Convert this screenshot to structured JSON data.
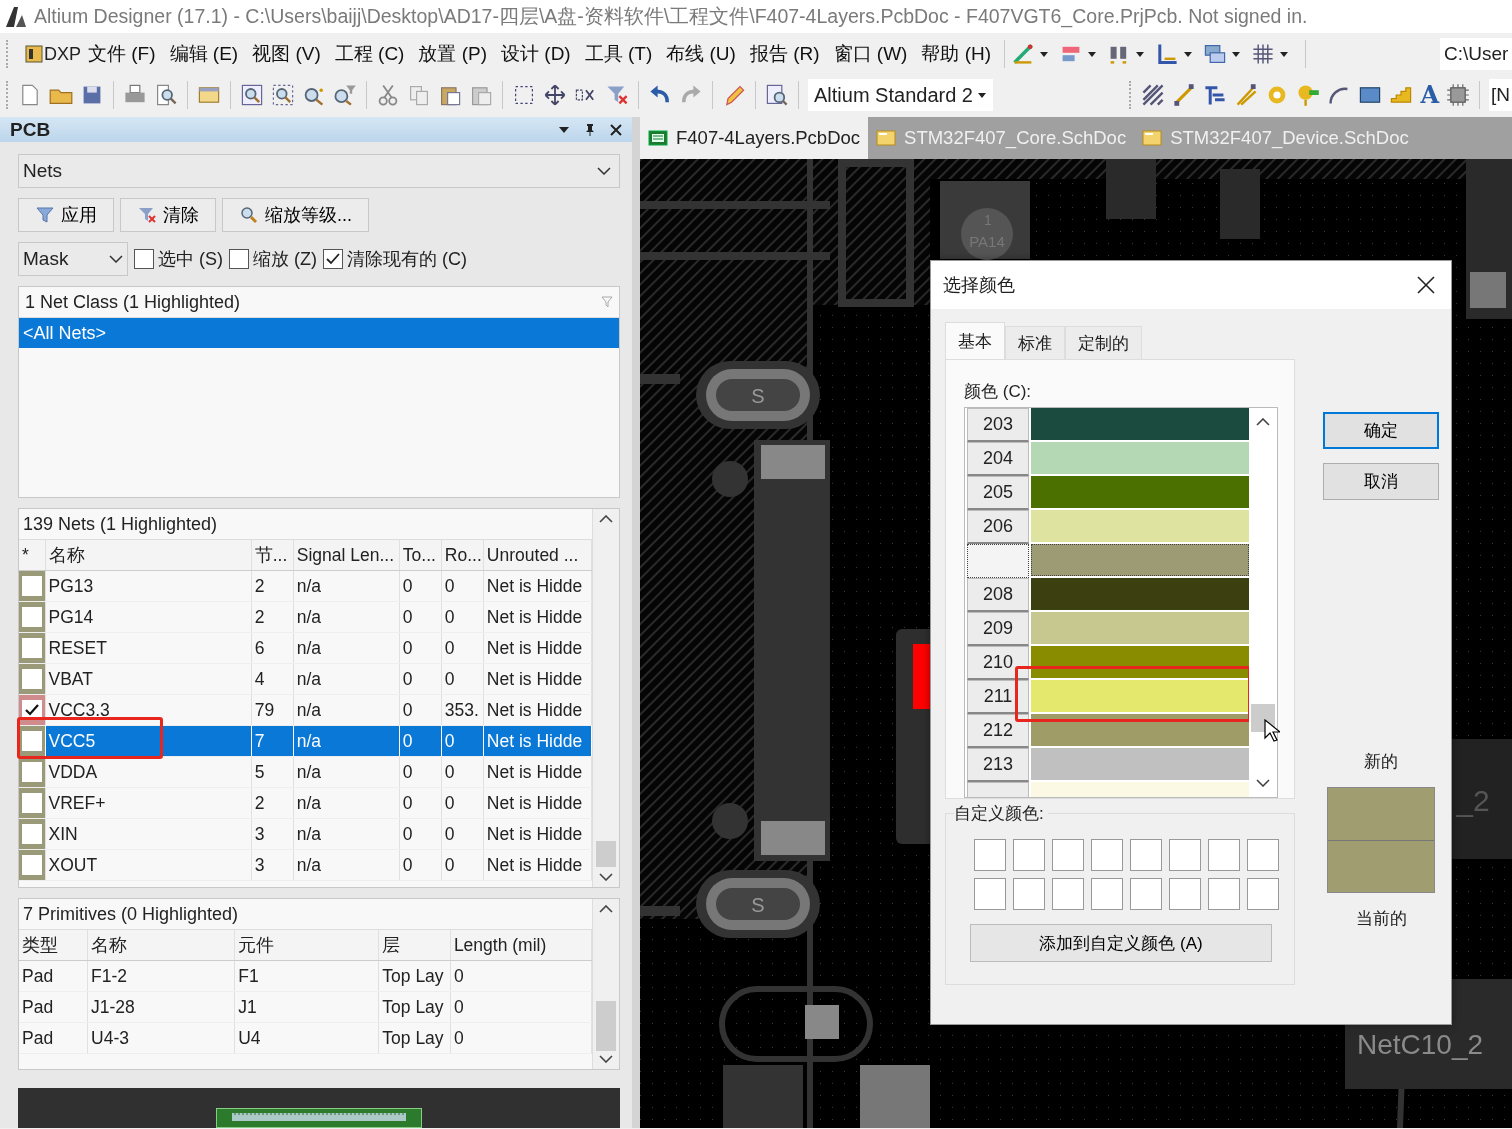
{
  "window": {
    "title": "Altium Designer (17.1) - C:\\Users\\baijj\\Desktop\\AD17-四层\\A盘-资料软件\\工程文件\\F407-4Layers.PcbDoc - F407VGT6_Core.PrjPcb. Not signed in."
  },
  "menu": [
    "DXP",
    "文件 (F)",
    "编辑 (E)",
    "视图 (V)",
    "工程 (C)",
    "放置 (P)",
    "设计 (D)",
    "工具 (T)",
    "布线 (U)",
    "报告 (R)",
    "窗口 (W)",
    "帮助 (H)"
  ],
  "toolbar": {
    "path_field": "C:\\User",
    "standard_dropdown": "Altium Standard 2",
    "string_tool": "A",
    "cut_field": "[N"
  },
  "panel": {
    "title": "PCB",
    "mode": "Nets",
    "buttons": [
      "应用",
      "清除",
      "缩放等级..."
    ],
    "mask": "Mask",
    "options": [
      {
        "label": "选中 (S)",
        "checked": false
      },
      {
        "label": "缩放 (Z)",
        "checked": false
      },
      {
        "label": "清除现有的 (C)",
        "checked": true
      }
    ],
    "classes": {
      "header": "1 Net Class (1 Highlighted)",
      "rows": [
        {
          "name": "<All Nets>",
          "selected": true
        }
      ]
    },
    "nets": {
      "header": "139 Nets (1 Highlighted)",
      "columns": [
        "*",
        "名称",
        "节...",
        "Signal Len...",
        "To...",
        "Ro...",
        "Unrouted ..."
      ],
      "rows": [
        {
          "checked": false,
          "color": "#9a9a78",
          "name": "PG13",
          "nodes": "2",
          "signal_length": "n/a",
          "to": "0",
          "ro": "0",
          "unrouted": "Net is Hidde",
          "selected": false,
          "annotated": false
        },
        {
          "checked": false,
          "color": "#9a9a78",
          "name": "PG14",
          "nodes": "2",
          "signal_length": "n/a",
          "to": "0",
          "ro": "0",
          "unrouted": "Net is Hidde",
          "selected": false,
          "annotated": false
        },
        {
          "checked": false,
          "color": "#9a9a78",
          "name": "RESET",
          "nodes": "6",
          "signal_length": "n/a",
          "to": "0",
          "ro": "0",
          "unrouted": "Net is Hidde",
          "selected": false,
          "annotated": false
        },
        {
          "checked": false,
          "color": "#9a9a78",
          "name": "VBAT",
          "nodes": "4",
          "signal_length": "n/a",
          "to": "0",
          "ro": "0",
          "unrouted": "Net is Hidde",
          "selected": false,
          "annotated": false
        },
        {
          "checked": true,
          "color": "#d08c8c",
          "name": "VCC3.3",
          "nodes": "79",
          "signal_length": "n/a",
          "to": "0",
          "ro": "353.",
          "unrouted": "Net is Hidde",
          "selected": false,
          "annotated": false
        },
        {
          "checked": false,
          "color": "#9a9a78",
          "name": "VCC5",
          "nodes": "7",
          "signal_length": "n/a",
          "to": "0",
          "ro": "0",
          "unrouted": "Net is Hidde",
          "selected": true,
          "annotated": true
        },
        {
          "checked": false,
          "color": "#9a9a78",
          "name": "VDDA",
          "nodes": "5",
          "signal_length": "n/a",
          "to": "0",
          "ro": "0",
          "unrouted": "Net is Hidde",
          "selected": false,
          "annotated": false
        },
        {
          "checked": false,
          "color": "#9a9a78",
          "name": "VREF+",
          "nodes": "2",
          "signal_length": "n/a",
          "to": "0",
          "ro": "0",
          "unrouted": "Net is Hidde",
          "selected": false,
          "annotated": false
        },
        {
          "checked": false,
          "color": "#9a9a78",
          "name": "XIN",
          "nodes": "3",
          "signal_length": "n/a",
          "to": "0",
          "ro": "0",
          "unrouted": "Net is Hidde",
          "selected": false,
          "annotated": false
        },
        {
          "checked": false,
          "color": "#9a9a78",
          "name": "XOUT",
          "nodes": "3",
          "signal_length": "n/a",
          "to": "0",
          "ro": "0",
          "unrouted": "Net is Hidde",
          "selected": false,
          "annotated": false
        }
      ]
    },
    "primitives": {
      "header": "7 Primitives (0 Highlighted)",
      "columns": [
        "类型",
        "名称",
        "元件",
        "层",
        "Length (mil)"
      ],
      "rows": [
        [
          "Pad",
          "F1-2",
          "F1",
          "Top Lay",
          "0"
        ],
        [
          "Pad",
          "J1-28",
          "J1",
          "Top Lay",
          "0"
        ],
        [
          "Pad",
          "U4-3",
          "U4",
          "Top Lay",
          "0"
        ]
      ]
    }
  },
  "documents": [
    {
      "label": "F407-4Layers.PcbDoc",
      "kind": "pcb",
      "selected": true
    },
    {
      "label": "STM32F407_Core.SchDoc",
      "kind": "sch",
      "selected": false
    },
    {
      "label": "STM32F407_Device.SchDoc",
      "kind": "sch",
      "selected": false
    }
  ],
  "canvas": {
    "labels": [
      "1",
      "PA14",
      "S",
      "S",
      "_2",
      "NetC10_2"
    ]
  },
  "dialog": {
    "title": "选择颜色",
    "tabs": [
      {
        "label": "基本",
        "selected": true
      },
      {
        "label": "标准",
        "selected": false
      },
      {
        "label": "定制的",
        "selected": false
      }
    ],
    "list_label": "颜色 (C):",
    "colors": [
      {
        "label": "203",
        "color": "#1b4a3e",
        "selected": false,
        "annotated": false
      },
      {
        "label": "204",
        "color": "#b4d8b4",
        "selected": false,
        "annotated": false
      },
      {
        "label": "205",
        "color": "#4c7000",
        "selected": false,
        "annotated": false
      },
      {
        "label": "206",
        "color": "#dfe3a0",
        "selected": false,
        "annotated": false
      },
      {
        "color": "#9c9b74",
        "selected": true,
        "annotated": false
      },
      {
        "label": "208",
        "color": "#3c3f10",
        "selected": false,
        "annotated": false
      },
      {
        "label": "209",
        "color": "#c6c890",
        "selected": false,
        "annotated": false
      },
      {
        "label": "210",
        "color": "#8a8c00",
        "selected": false,
        "annotated": false
      },
      {
        "label": "211",
        "color": "#e4e86c",
        "selected": false,
        "annotated": true
      },
      {
        "label": "212",
        "color": "#a09c68",
        "selected": false,
        "annotated": false
      },
      {
        "label": "213",
        "color": "#c0c0c0",
        "selected": false,
        "annotated": false
      },
      {
        "color": "#fbf9e4",
        "selected": false,
        "annotated": false
      }
    ],
    "buttons": [
      {
        "label": "确定",
        "kind": "default"
      },
      {
        "label": "取消",
        "kind": "normal"
      }
    ],
    "preview": [
      {
        "label": "新的",
        "color": "#a09e70"
      },
      {
        "label": "当前的",
        "color": "#a09e70"
      }
    ],
    "custom_label": "自定义颜色:",
    "add_button": "添加到自定义颜色 (A)"
  }
}
